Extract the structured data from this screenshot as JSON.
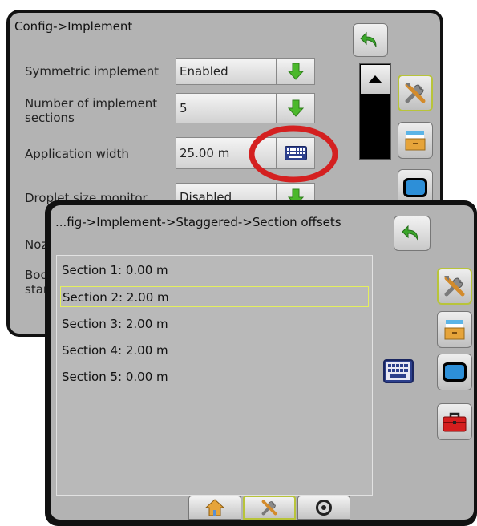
{
  "back_panel": {
    "title": "Config->Implement",
    "settings": [
      {
        "label": "Symmetric implement",
        "value": "Enabled"
      },
      {
        "label": "Number of implement sections",
        "value": "5"
      },
      {
        "label": "Application width",
        "value": "25.00 m"
      },
      {
        "label": "Droplet size monitor",
        "value": "Disabled"
      },
      {
        "label": "Nozz",
        "value": ""
      },
      {
        "label": "Boom start",
        "value": ""
      }
    ]
  },
  "front_panel": {
    "title": "...fig->Implement->Staggered->Section offsets",
    "sections": [
      {
        "label": "Section 1: 0.00 m",
        "selected": false
      },
      {
        "label": "Section 2: 2.00 m",
        "selected": true
      },
      {
        "label": "Section 3: 2.00 m",
        "selected": false
      },
      {
        "label": "Section 4: 2.00 m",
        "selected": false
      },
      {
        "label": "Section 5: 0.00 m",
        "selected": false
      }
    ]
  },
  "icons": {
    "back": "back-arrow-icon",
    "tools": "tools-icon",
    "drawer": "drawer-icon",
    "display": "display-icon",
    "toolbox": "toolbox-icon",
    "keyboard": "keyboard-icon",
    "home": "home-icon",
    "gauge": "gauge-icon",
    "dropdown": "green-down-arrow-icon"
  },
  "colors": {
    "screen_bg": "#b3b3b3",
    "panel_frame": "#111111",
    "highlight_circle": "#d42020",
    "selection_outline": "#e4ef5e",
    "active_border": "#b8c43a",
    "dropdown_arrow": "#4bb82b"
  }
}
